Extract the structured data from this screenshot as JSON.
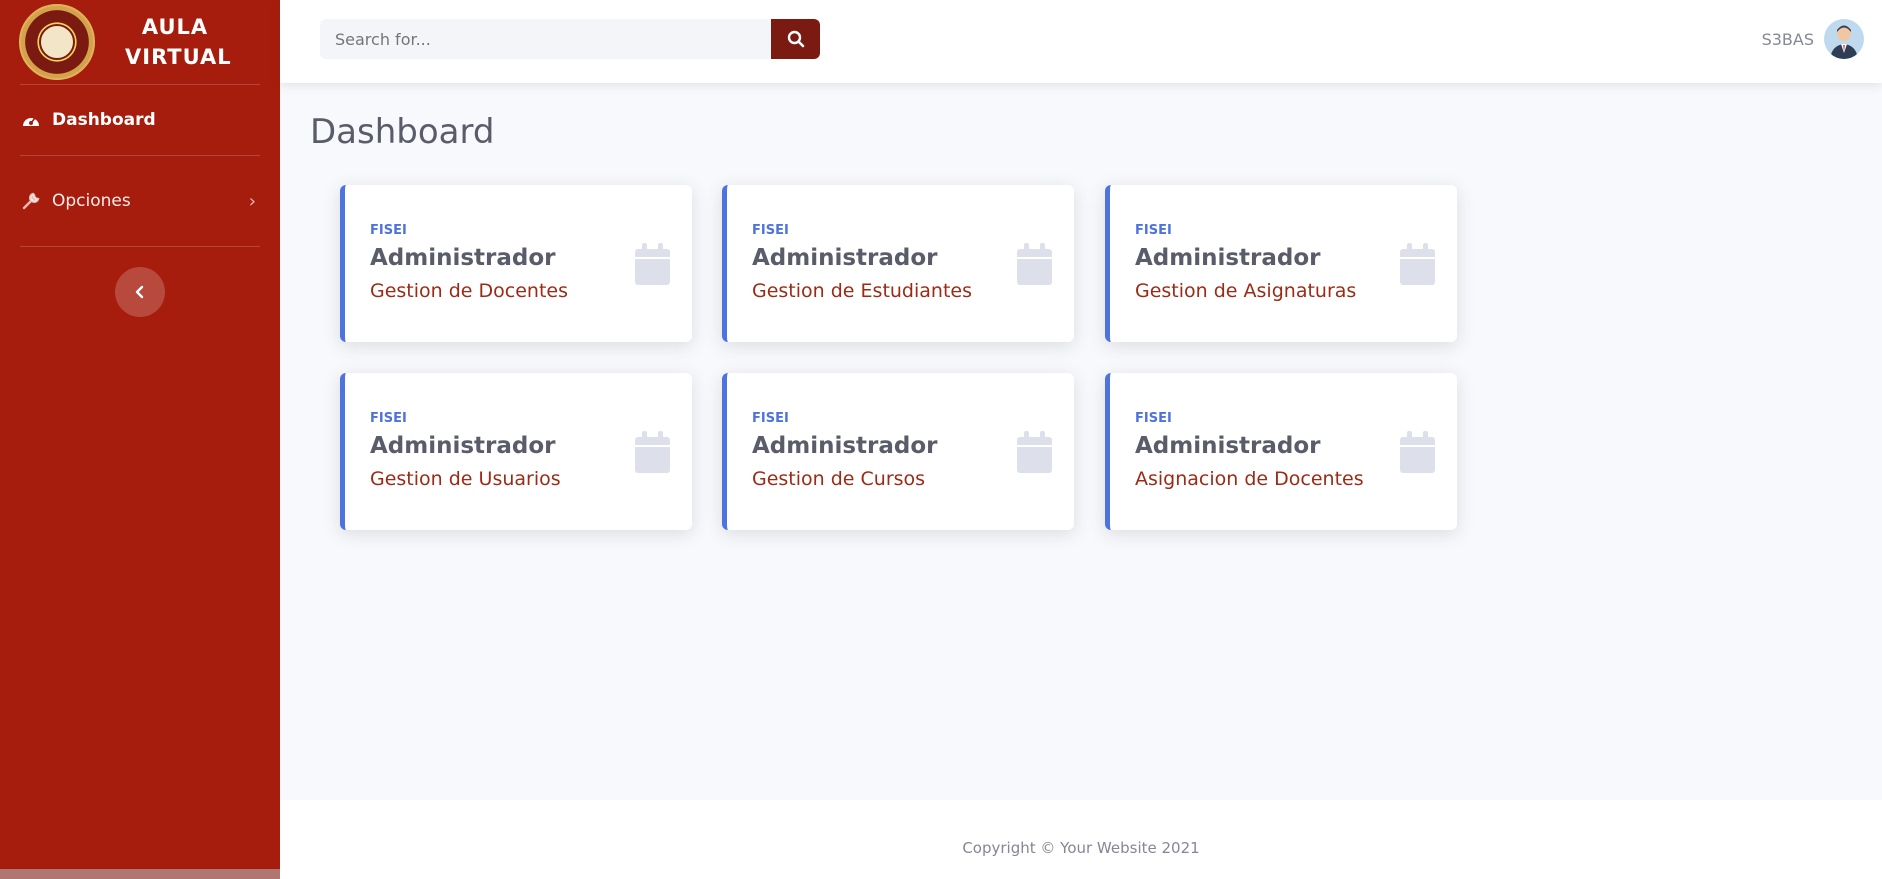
{
  "sidebar": {
    "brand_line1": "AULA",
    "brand_line2": "VIRTUAL",
    "items": [
      {
        "label": "Dashboard",
        "icon": "tachometer-icon"
      },
      {
        "label": "Opciones",
        "icon": "wrench-icon"
      }
    ]
  },
  "topbar": {
    "search_placeholder": "Search for...",
    "user_name": "S3BAS"
  },
  "main": {
    "title": "Dashboard",
    "cards": [
      {
        "label": "FISEI",
        "role": "Administrador",
        "desc": "Gestion de Docentes"
      },
      {
        "label": "FISEI",
        "role": "Administrador",
        "desc": "Gestion de Estudiantes"
      },
      {
        "label": "FISEI",
        "role": "Administrador",
        "desc": "Gestion de Asignaturas"
      },
      {
        "label": "FISEI",
        "role": "Administrador",
        "desc": "Gestion de Usuarios"
      },
      {
        "label": "FISEI",
        "role": "Administrador",
        "desc": "Gestion de Cursos"
      },
      {
        "label": "FISEI",
        "role": "Administrador",
        "desc": "Asignacion de Docentes"
      }
    ]
  },
  "footer": {
    "copyright": "Copyright © Your Website 2021"
  },
  "colors": {
    "sidebar": "#a61d0d",
    "accent": "#4e73df",
    "search_button": "#7a1a10",
    "card_desc": "#9c2b16"
  }
}
